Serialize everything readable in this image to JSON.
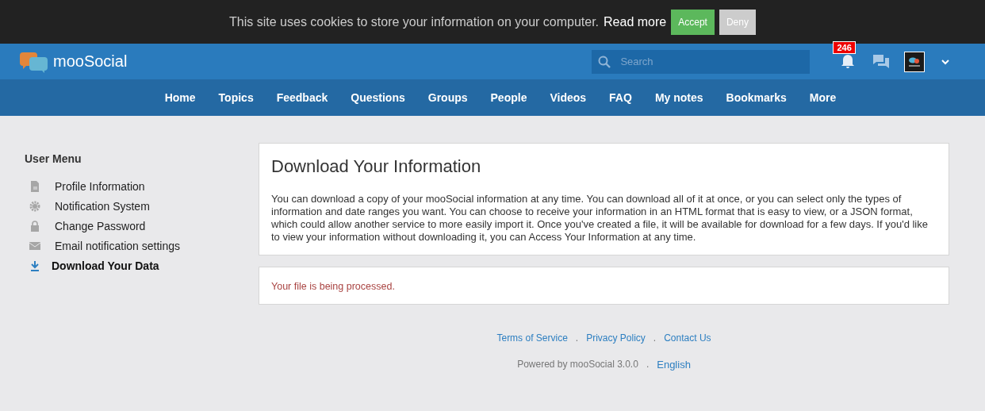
{
  "cookie_bar": {
    "message": "This site uses cookies to store your information on your computer.",
    "read_more": "Read more",
    "accept": "Accept",
    "deny": "Deny"
  },
  "header": {
    "logo": "mooSocial",
    "search": {
      "placeholder": "Search"
    },
    "notification_count": "246"
  },
  "nav": [
    "Home",
    "Topics",
    "Feedback",
    "Questions",
    "Groups",
    "People",
    "Videos",
    "FAQ",
    "My notes",
    "Bookmarks",
    "More"
  ],
  "sidebar": {
    "title": "User Menu",
    "items": [
      {
        "label": "Profile Information",
        "kind": "profile",
        "selected": false
      },
      {
        "label": "Notification System",
        "kind": "settings",
        "selected": false
      },
      {
        "label": "Change Password",
        "kind": "password",
        "selected": false
      },
      {
        "label": "Email notification settings",
        "kind": "email",
        "selected": false
      },
      {
        "label": "Download Your Data",
        "kind": "download",
        "selected": true
      }
    ]
  },
  "main": {
    "title": "Download Your Information",
    "description": "You can download a copy of your mooSocial information at any time. You can download all of it at once, or you can select only the types of information and date ranges you want. You can choose to receive your information in an HTML format that is easy to view, or a JSON format, which could allow another service to more easily import it. Once you've created a file, it will be available for download for a few days. If you'd like to view your information without downloading it, you can Access Your Information at any time.",
    "status": "Your file is being processed."
  },
  "footer": {
    "links": [
      "Terms of Service",
      "Privacy Policy",
      "Contact Us"
    ],
    "separator": ".",
    "powered_by": "Powered by mooSocial 3.0.0",
    "language": "English"
  }
}
